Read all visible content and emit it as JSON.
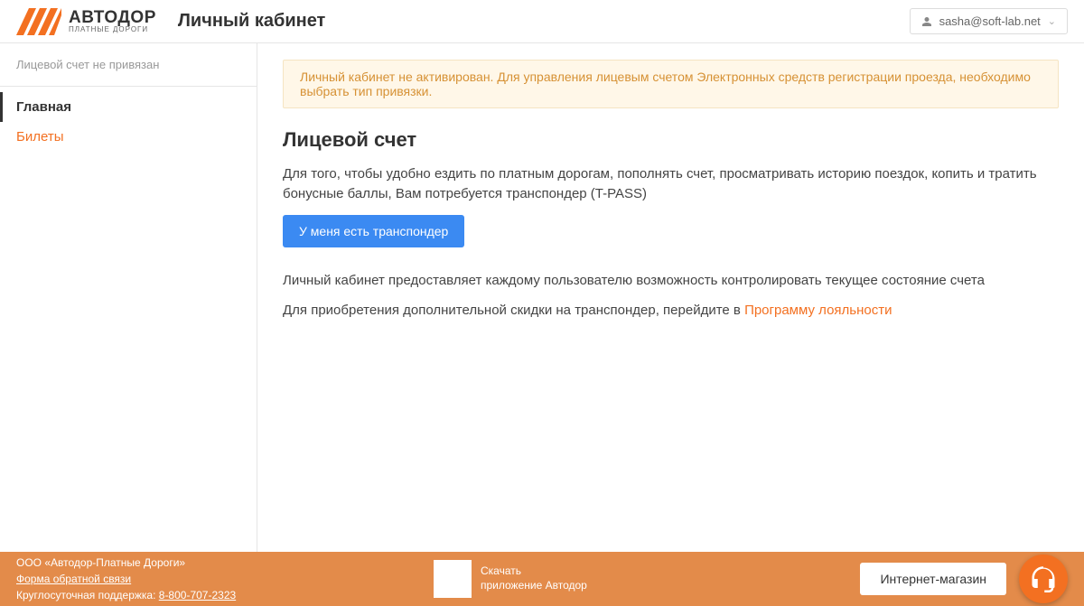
{
  "header": {
    "logo_line1": "АВТОДОР",
    "logo_line2": "ПЛАТНЫЕ ДОРОГИ",
    "page_title": "Личный кабинет",
    "user_email": "sasha@soft-lab.net"
  },
  "sidebar": {
    "status_text": "Лицевой счет не привязан",
    "items": [
      {
        "label": "Главная",
        "active": true
      },
      {
        "label": "Билеты",
        "active": false
      }
    ]
  },
  "main": {
    "alert_text": "Личный кабинет не активирован. Для управления лицевым счетом Электронных средств регистрации проезда, необходимо выбрать тип привязки.",
    "heading": "Лицевой счет",
    "intro_text": "Для того, чтобы удобно ездить по платным дорогам, пополнять счет, просматривать историю поездок, копить и тратить бонусные баллы, Вам потребуется транспондер (T-PASS)",
    "primary_button": "У меня есть транспондер",
    "desc_text": "Личный кабинет предоставляет каждому пользователю возможность контролировать текущее состояние счета",
    "discount_prefix": "Для приобретения дополнительной скидки на транспондер, перейдите в ",
    "discount_link": "Программу лояльности"
  },
  "footer": {
    "company": "ООО «Автодор-Платные Дороги»",
    "feedback_link": "Форма обратной связи",
    "support_prefix": "Круглосуточная поддержка: ",
    "support_phone": "8-800-707-2323",
    "download_line1": "Скачать",
    "download_line2": "приложение Автодор",
    "shop_button": "Интернет-магазин"
  }
}
